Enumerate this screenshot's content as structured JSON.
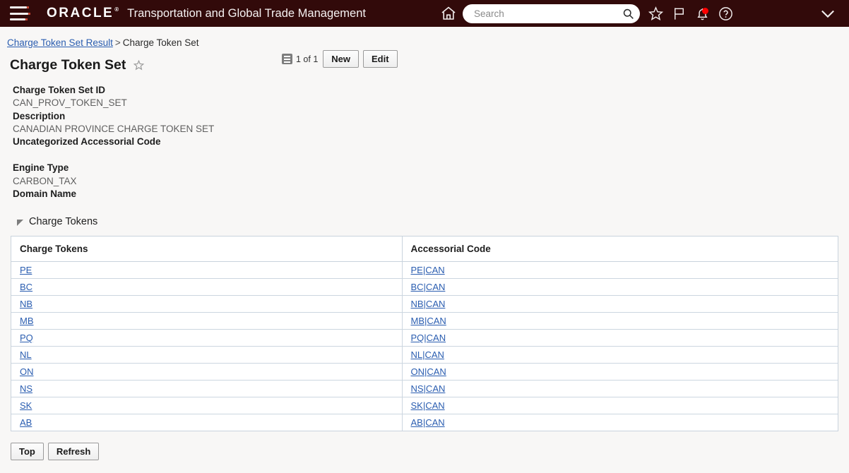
{
  "header": {
    "menu_icon": "hamburger-icon",
    "brand": "ORACLE",
    "brand_tm": "®",
    "app_name": "Transportation and Global Trade Management",
    "home_icon": "home-icon",
    "search": {
      "placeholder": "Search",
      "value": "",
      "icon": "search-icon"
    },
    "icons": [
      {
        "name": "favorites-star-icon",
        "glyph": "star"
      },
      {
        "name": "flag-icon",
        "glyph": "flag"
      },
      {
        "name": "notifications-bell-icon",
        "glyph": "bell",
        "badge": true
      },
      {
        "name": "help-icon",
        "glyph": "question-circle"
      }
    ],
    "user_menu_icon": "chevron-down-icon"
  },
  "breadcrumb": {
    "parent": "Charge Token Set Result",
    "separator": ">",
    "current": "Charge Token Set"
  },
  "page": {
    "title": "Charge Token Set",
    "favorite_icon": "star-outline-icon",
    "record_count": "1 of 1",
    "list_icon": "list-view-icon",
    "buttons": [
      {
        "label": "New",
        "name": "new-button"
      },
      {
        "label": "Edit",
        "name": "edit-button"
      }
    ]
  },
  "details": [
    {
      "label": "Charge Token Set ID",
      "value": "CAN_PROV_TOKEN_SET"
    },
    {
      "label": "Description",
      "value": "CANADIAN PROVINCE CHARGE TOKEN SET"
    },
    {
      "label": "Uncategorized Accessorial Code",
      "value": ""
    },
    {
      "label": "Engine Type",
      "value": "CARBON_TAX"
    },
    {
      "label": "Domain Name",
      "value": ""
    }
  ],
  "section": {
    "title": "Charge Tokens",
    "expanded": true,
    "disclosure_icon": "triangle-expanded-icon"
  },
  "table": {
    "columns": [
      "Charge Tokens",
      "Accessorial Code"
    ],
    "rows": [
      {
        "charge_token": "PE",
        "accessorial_code": "PE|CAN"
      },
      {
        "charge_token": "BC",
        "accessorial_code": "BC|CAN"
      },
      {
        "charge_token": "NB",
        "accessorial_code": "NB|CAN"
      },
      {
        "charge_token": "MB",
        "accessorial_code": "MB|CAN"
      },
      {
        "charge_token": "PQ",
        "accessorial_code": "PQ|CAN"
      },
      {
        "charge_token": "NL",
        "accessorial_code": "NL|CAN"
      },
      {
        "charge_token": "ON",
        "accessorial_code": "ON|CAN"
      },
      {
        "charge_token": "NS",
        "accessorial_code": "NS|CAN"
      },
      {
        "charge_token": "SK",
        "accessorial_code": "SK|CAN"
      },
      {
        "charge_token": "AB",
        "accessorial_code": "AB|CAN"
      }
    ]
  },
  "footer": {
    "buttons": [
      {
        "label": "Top",
        "name": "top-button"
      },
      {
        "label": "Refresh",
        "name": "refresh-button"
      }
    ]
  },
  "colors": {
    "header_bg": "#320a0a",
    "link": "#2a5db0",
    "accent_red": "#c74634",
    "page_bg": "#f8f7f6",
    "badge_red": "#ff0000"
  }
}
